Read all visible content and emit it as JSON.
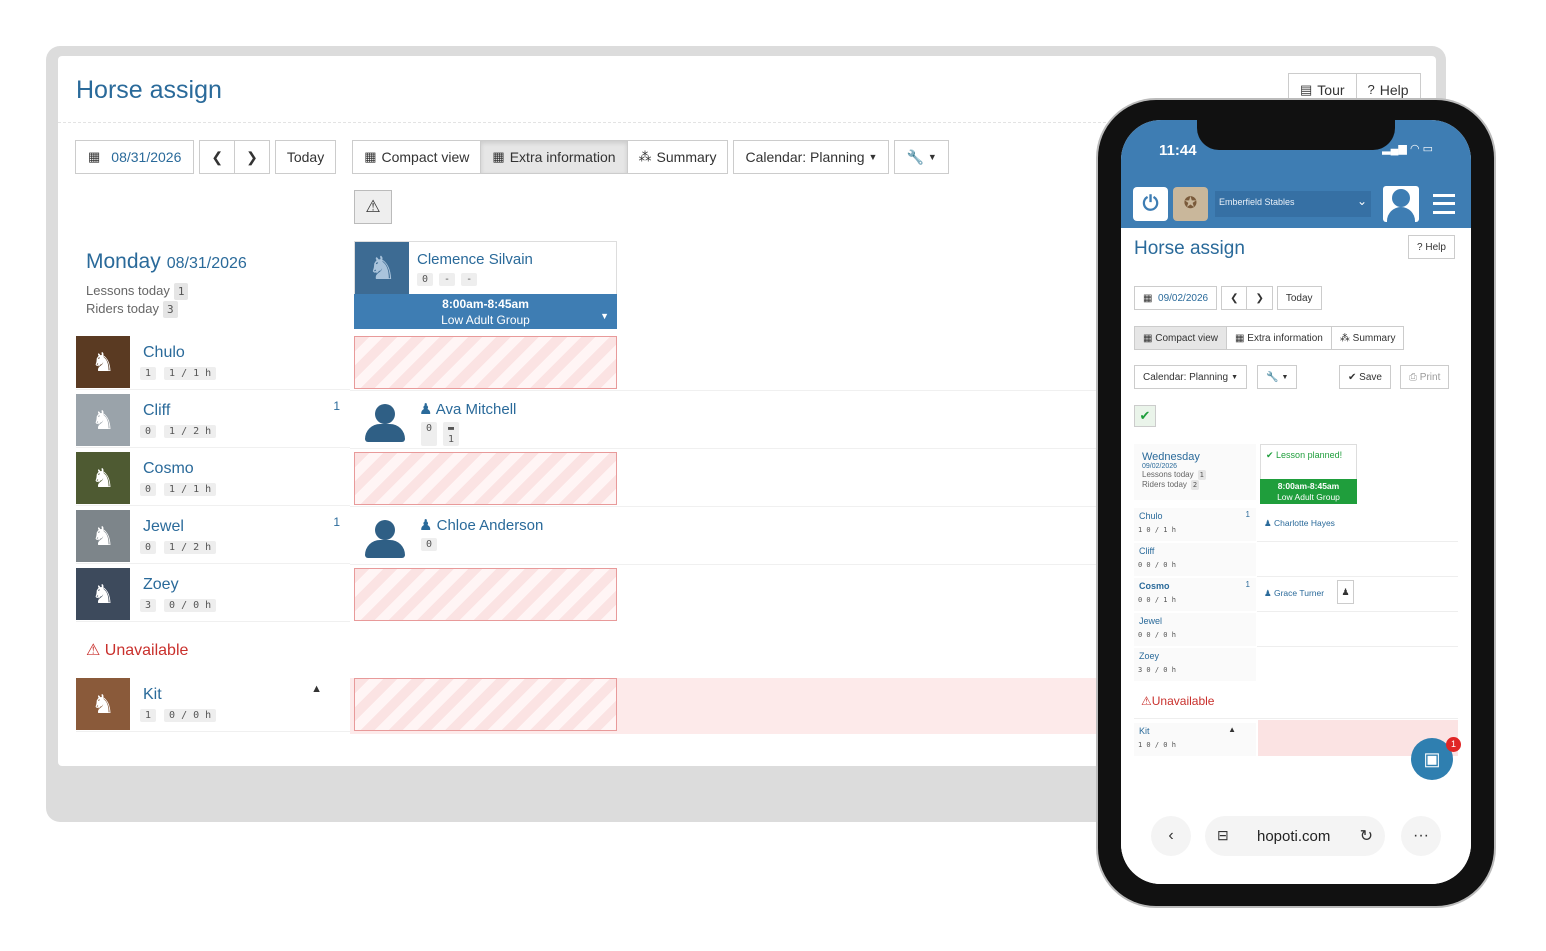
{
  "desktop": {
    "title": "Horse assign",
    "tour_label": "Tour",
    "help_label": "Help",
    "date": "08/31/2026",
    "today_label": "Today",
    "views": [
      "Compact view",
      "Extra information",
      "Summary"
    ],
    "calendar_label": "Calendar: Planning",
    "day": {
      "name": "Monday",
      "date": "08/31/2026",
      "lessons_label": "Lessons today",
      "lessons_count": "1",
      "riders_label": "Riders today",
      "riders_count": "3"
    },
    "lesson": {
      "instructor": "Clemence Silvain",
      "pills": [
        "0",
        "-",
        "-"
      ],
      "time": "8:00am-8:45am",
      "group": "Low Adult Group"
    },
    "horses": [
      {
        "name": "Chulo",
        "p1": "1",
        "p2": "1 / 1 h",
        "count": ""
      },
      {
        "name": "Cliff",
        "p1": "0",
        "p2": "1 / 2 h",
        "count": "1"
      },
      {
        "name": "Cosmo",
        "p1": "0",
        "p2": "1 / 1 h",
        "count": ""
      },
      {
        "name": "Jewel",
        "p1": "0",
        "p2": "1 / 2 h",
        "count": "1"
      },
      {
        "name": "Zoey",
        "p1": "3",
        "p2": "0 / 0 h",
        "count": ""
      }
    ],
    "assignments": [
      {
        "rider": "Ava Mitchell",
        "p1": "0",
        "p2": "1"
      },
      {
        "rider": "Chloe Anderson",
        "p1": "0"
      }
    ],
    "unavailable_label": "Unavailable",
    "unavailable_horse": {
      "name": "Kit",
      "p1": "1",
      "p2": "0 / 0 h"
    }
  },
  "phone": {
    "time": "11:44",
    "stable": "Emberfield Stables",
    "title": "Horse assign",
    "help_label": "Help",
    "date": "09/02/2026",
    "today_label": "Today",
    "views": [
      "Compact view",
      "Extra information",
      "Summary"
    ],
    "calendar_label": "Calendar: Planning",
    "save_label": "Save",
    "print_label": "Print",
    "day": {
      "name": "Wednesday",
      "date": "09/02/2026",
      "lessons_label": "Lessons today",
      "lessons_count": "1",
      "riders_label": "Riders today",
      "riders_count": "2"
    },
    "lesson": {
      "status": "Lesson planned!",
      "time": "8:00am-8:45am",
      "group": "Low Adult Group"
    },
    "horses": [
      {
        "name": "Chulo",
        "pills": "1  0 / 1 h",
        "count": "1"
      },
      {
        "name": "Cliff",
        "pills": "0  0 / 0 h",
        "count": ""
      },
      {
        "name": "Cosmo",
        "pills": "0  0 / 1 h",
        "count": "1"
      },
      {
        "name": "Jewel",
        "pills": "0  0 / 0 h",
        "count": ""
      },
      {
        "name": "Zoey",
        "pills": "3  0 / 0 h",
        "count": ""
      }
    ],
    "assignments": [
      "Charlotte Hayes",
      "Grace Turner"
    ],
    "unavailable_label": "Unavailable",
    "unavailable_horse": {
      "name": "Kit",
      "pills": "1  0 / 0 h"
    },
    "chat_badge": "1",
    "url": "hopoti.com"
  }
}
